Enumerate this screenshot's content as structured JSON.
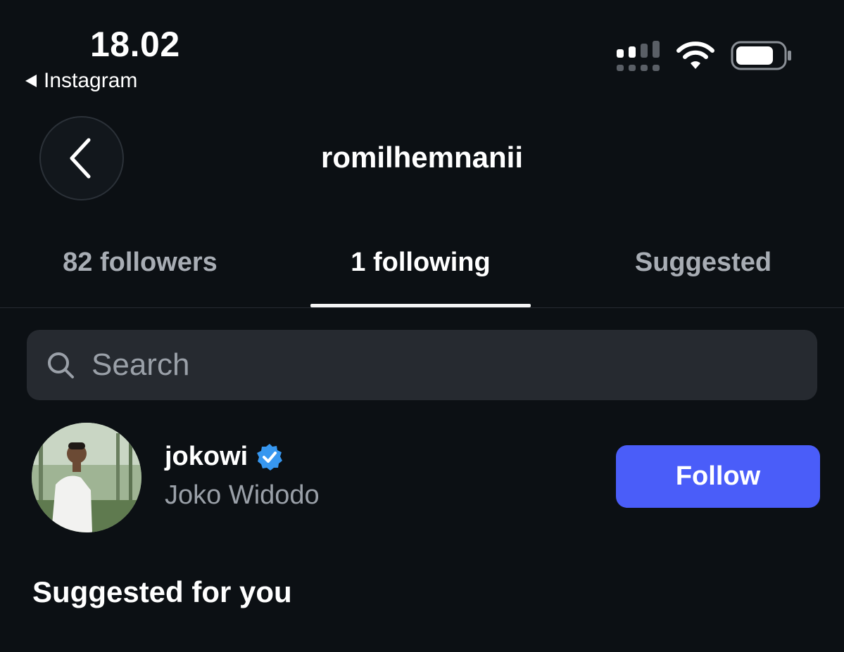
{
  "status_bar": {
    "time": "18.02",
    "back_app": "Instagram"
  },
  "header": {
    "title": "romilhemnanii"
  },
  "tabs": [
    {
      "label": "82 followers",
      "active": false
    },
    {
      "label": "1 following",
      "active": true
    },
    {
      "label": "Suggested",
      "active": false
    }
  ],
  "search": {
    "placeholder": "Search",
    "value": ""
  },
  "following_list": [
    {
      "username": "jokowi",
      "full_name": "Joko Widodo",
      "verified": true,
      "action_label": "Follow"
    }
  ],
  "suggested_section": {
    "heading": "Suggested for you"
  },
  "colors": {
    "background": "#0c1014",
    "follow_button": "#4a5df9",
    "verified_badge": "#3797f0",
    "search_bg": "#262a30",
    "secondary_text": "#9aa0a8"
  },
  "icons": {
    "back": "chevron-left-icon",
    "search": "search-icon",
    "verified": "verified-badge-icon",
    "signal": "signal-icon",
    "wifi": "wifi-icon",
    "battery": "battery-icon"
  }
}
